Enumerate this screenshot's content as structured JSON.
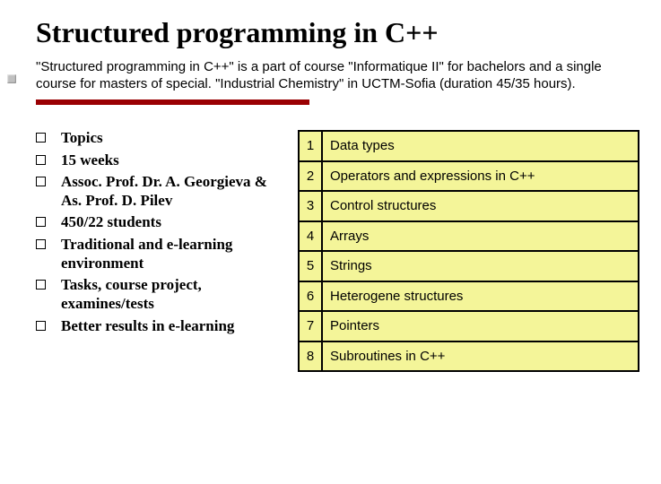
{
  "title": "Structured programming in C++",
  "subtitle": "\"Structured programming in C++\" is a part of course \"Informatique II\" for bachelors  and a single course for masters of special. \"Industrial Chemistry\" in UCTM-Sofia (duration 45/35 hours).",
  "bullets": [
    "Topics",
    "15 weeks",
    "Assoc. Prof. Dr. A. Georgieva & As. Prof. D. Pilev",
    "450/22 students",
    "Traditional and e-learning environment",
    "Tasks, course project, examines/tests",
    "Better results in e-learning"
  ],
  "topics": [
    {
      "n": "1",
      "name": "Data types"
    },
    {
      "n": "2",
      "name": "Operators and expressions in C++"
    },
    {
      "n": "3",
      "name": "Control structures"
    },
    {
      "n": "4",
      "name": "Arrays"
    },
    {
      "n": "5",
      "name": "Strings"
    },
    {
      "n": "6",
      "name": "Heterogene structures"
    },
    {
      "n": "7",
      "name": "Pointers"
    },
    {
      "n": "8",
      "name": "Subroutines in C++"
    }
  ]
}
